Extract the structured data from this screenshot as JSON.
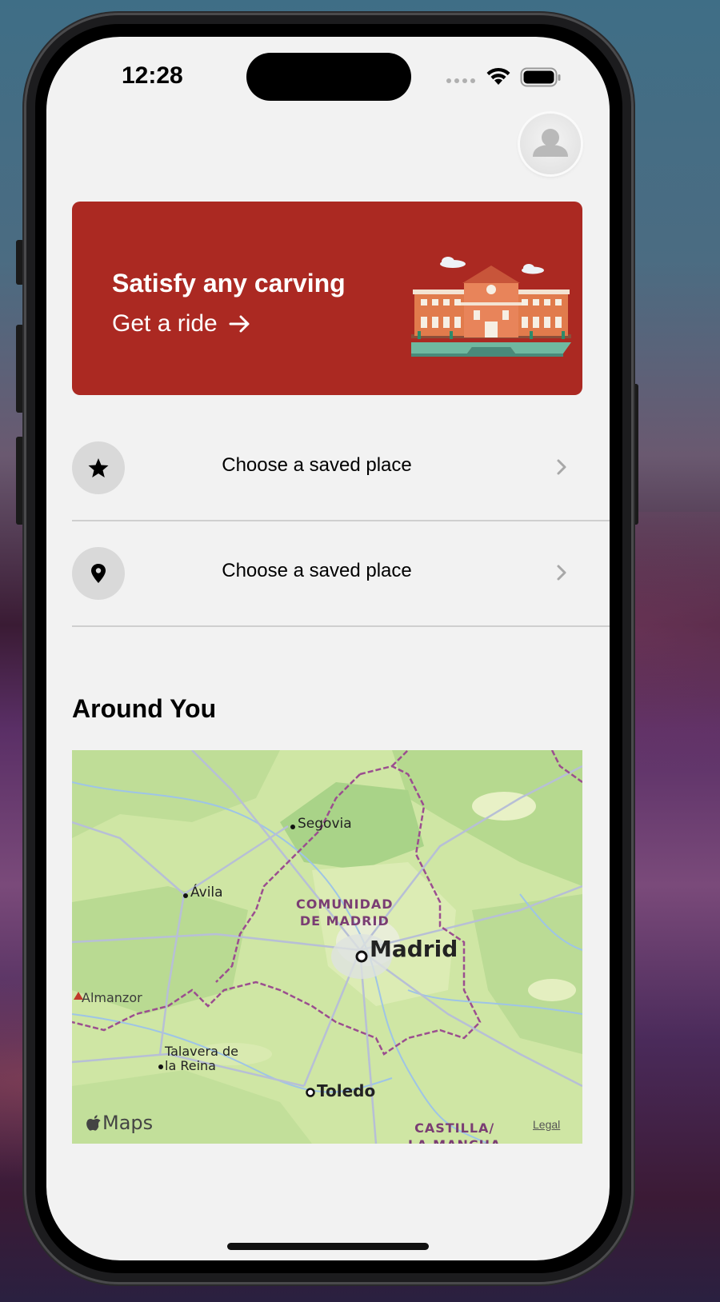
{
  "status_bar": {
    "time": "12:28"
  },
  "promo": {
    "title": "Satisfy any carving",
    "cta_label": "Get a ride",
    "accent": "#ab2922"
  },
  "saved_places": [
    {
      "icon": "star-icon",
      "label": "Choose a saved place"
    },
    {
      "icon": "location-pin-icon",
      "label": "Choose a saved place"
    }
  ],
  "around": {
    "title": "Around You",
    "map": {
      "cities": [
        "Segovia",
        "Ávila",
        "Madrid",
        "Toledo"
      ],
      "talavera_line1": "Talavera de",
      "talavera_line2": "la Reina",
      "peak": "Almanzor",
      "region1_line1": "COMUNIDAD",
      "region1_line2": "DE MADRID",
      "region2_line1": "CASTILLA/",
      "region2_line2": "LA MANCHA",
      "brand": "Maps",
      "legal": "Legal"
    }
  }
}
